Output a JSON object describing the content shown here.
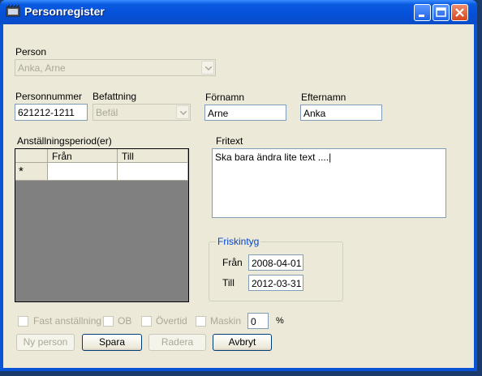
{
  "window": {
    "title": "Personregister"
  },
  "person": {
    "label": "Person",
    "value": "Anka, Arne"
  },
  "personnummer": {
    "label": "Personnummer",
    "value": "621212-1211"
  },
  "befattning": {
    "label": "Befattning",
    "value": "Befäl"
  },
  "fornamn": {
    "label": "Förnamn",
    "value": "Arne"
  },
  "efternamn": {
    "label": "Efternamn",
    "value": "Anka"
  },
  "anstallning": {
    "label": "Anställningsperiod(er)",
    "columns": [
      "Från",
      "Till"
    ],
    "new_row_marker": "*"
  },
  "fritext": {
    "label": "Fritext",
    "value": "Ska bara ändra lite text ....|"
  },
  "friskintyg": {
    "title": "Friskintyg",
    "from_label": "Från",
    "from_value": "2008-04-01",
    "to_label": "Till",
    "to_value": "2012-03-31"
  },
  "options": {
    "fast": "Fast anställning",
    "ob": "OB",
    "overtid": "Övertid",
    "maskin": "Maskin",
    "percent_value": "0",
    "percent_unit": "%"
  },
  "buttons": {
    "ny_person": "Ny person",
    "spara": "Spara",
    "radera": "Radera",
    "avbryt": "Avbryt"
  }
}
